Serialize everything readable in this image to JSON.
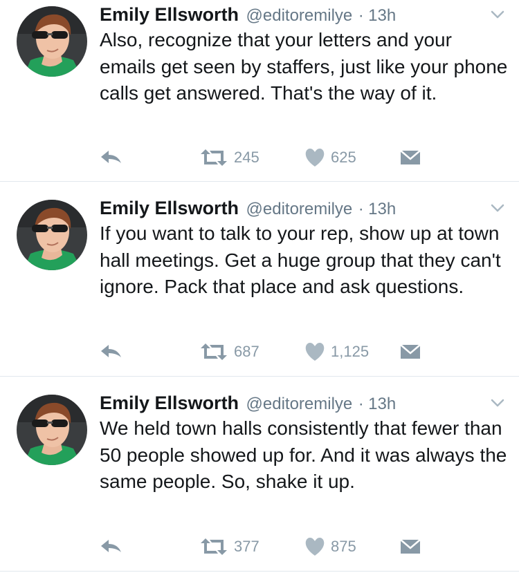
{
  "tweets": [
    {
      "name": "Emily Ellsworth",
      "handle": "@editoremilye",
      "separator": "·",
      "time": "13h",
      "text": "Also, recognize that your letters and your emails get seen by staffers, just like your phone calls get answered. That's the way of it.",
      "retweets": "245",
      "likes": "625"
    },
    {
      "name": "Emily Ellsworth",
      "handle": "@editoremilye",
      "separator": "·",
      "time": "13h",
      "text": "If you want to talk to your rep, show up at town hall meetings. Get a huge group that they can't ignore. Pack that place and ask questions.",
      "retweets": "687",
      "likes": "1,125"
    },
    {
      "name": "Emily Ellsworth",
      "handle": "@editoremilye",
      "separator": "·",
      "time": "13h",
      "text": "We held town halls consistently that fewer than 50 people showed up for. And it was always the same people. So, shake it up.",
      "retweets": "377",
      "likes": "875"
    }
  ],
  "colors": {
    "text": "#14171a",
    "muted": "#657786",
    "action_icon": "#8899a6",
    "divider": "#e1e8ed"
  },
  "icons": {
    "reply": "reply-arrow-icon",
    "retweet": "retweet-icon",
    "like": "heart-icon",
    "dm": "envelope-icon",
    "menu": "chevron-down-icon"
  }
}
